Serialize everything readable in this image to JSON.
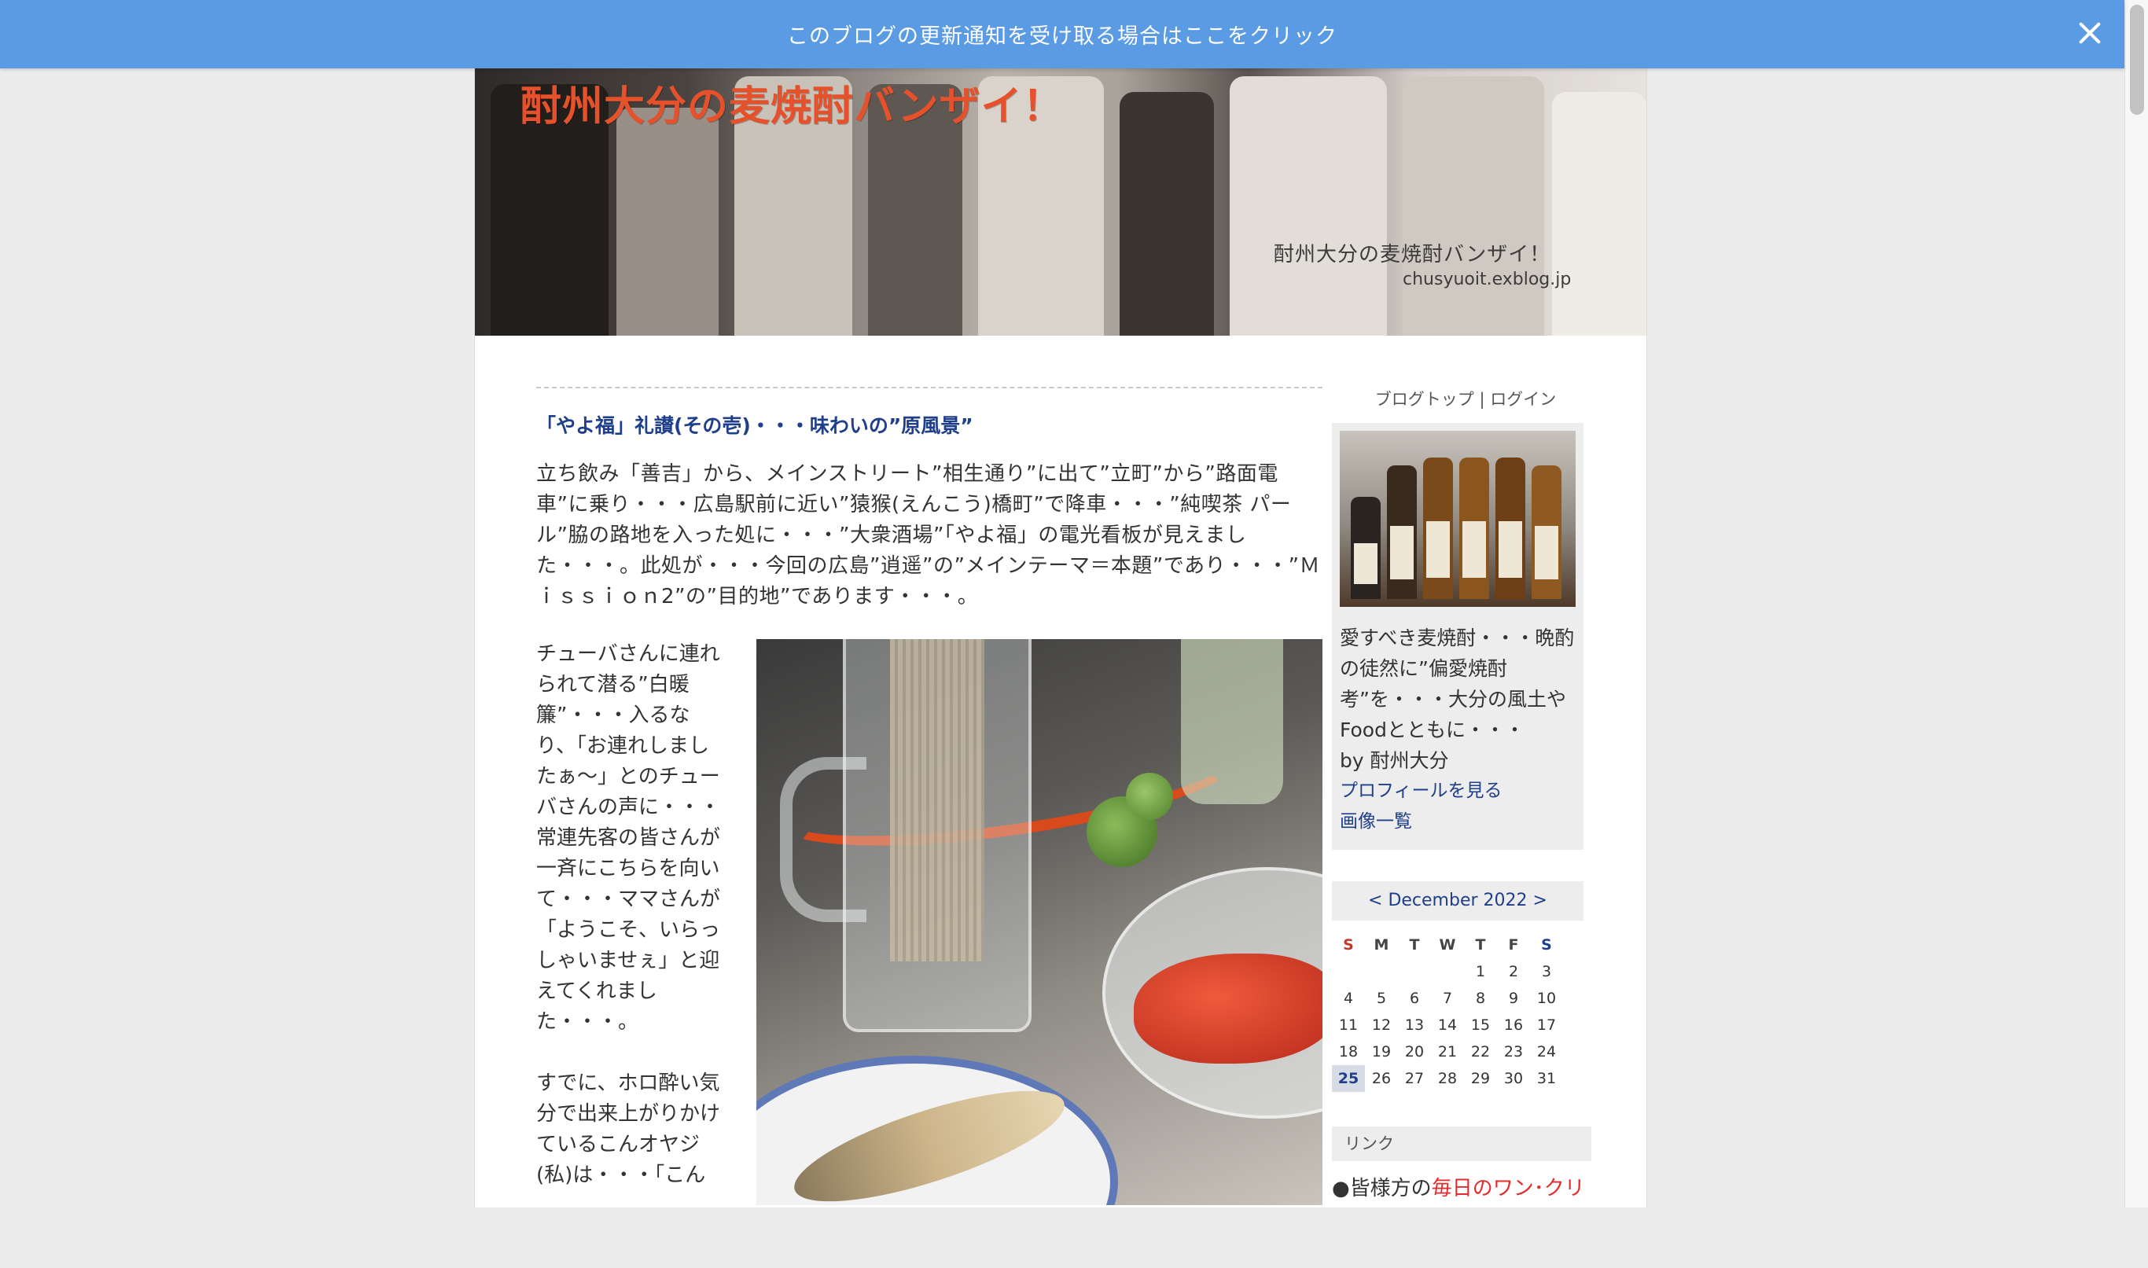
{
  "notification": {
    "text": "このブログの更新通知を受け取る場合はここをクリック"
  },
  "header": {
    "title": "酎州大分の麦焼酎バンザイ！",
    "subtitle": "酎州大分の麦焼酎バンザイ！",
    "url": "chusyuoit.exblog.jp"
  },
  "post": {
    "title": "「やよ福」礼讃(その壱)・・・味わいの”原風景”",
    "intro": "立ち飲み「善吉」から、メインストリート”相生通り”に出て”立町”から”路面電車”に乗り・・・広島駅前に近い”猿猴(えんこう)橋町”で降車・・・”純喫茶 パール”脇の路地を入った処に・・・”大衆酒場”「やよ福」の電光看板が見えました・・・。此処が・・・今回の広島”逍遥”の”メインテーマ＝本題”であり・・・”Ｍｉｓｓｉｏｎ2”の”目的地”であります・・・。",
    "side_para1": "チューバさんに連れられて潜る”白暖簾”・・・入るなり、「お連れしましたぁ～」とのチューバさんの声に・・・常連先客の皆さんが一斉にこちらを向いて・・・ママさんが「ようこそ、いらっしゃいませぇ」と迎えてくれました・・・。",
    "side_para2": "すでに、ホロ酔い気分で出来上がりかけているこんオヤジ(私)は・・・「こん"
  },
  "sidebar": {
    "blog_top": "ブログトップ",
    "separator": "|",
    "login": "ログイン",
    "description": "愛すべき麦焼酎・・・晩酌の徒然に”偏愛焼酎考”を・・・大分の風土やFoodとともに・・・",
    "author": "by 酎州大分",
    "profile_link": "プロフィールを見る",
    "images_link": "画像一覧",
    "links_header": "リンク",
    "link_prefix": "●皆様方の",
    "link_text": "毎日のワン･クリ"
  },
  "calendar": {
    "prev": "<",
    "month": "December 2022",
    "next": ">",
    "days_of_week": [
      "S",
      "M",
      "T",
      "W",
      "T",
      "F",
      "S"
    ],
    "weeks": [
      [
        "",
        "",
        "",
        "",
        "1",
        "2",
        "3"
      ],
      [
        "4",
        "5",
        "6",
        "7",
        "8",
        "9",
        "10"
      ],
      [
        "11",
        "12",
        "13",
        "14",
        "15",
        "16",
        "17"
      ],
      [
        "18",
        "19",
        "20",
        "21",
        "22",
        "23",
        "24"
      ],
      [
        "25",
        "26",
        "27",
        "28",
        "29",
        "30",
        "31"
      ]
    ],
    "today": "25"
  },
  "colors": {
    "notify_bar": "#5a9be3",
    "title_link": "#1f3f8a",
    "banner_title": "#e5512b",
    "link_red": "#e52b2b"
  }
}
